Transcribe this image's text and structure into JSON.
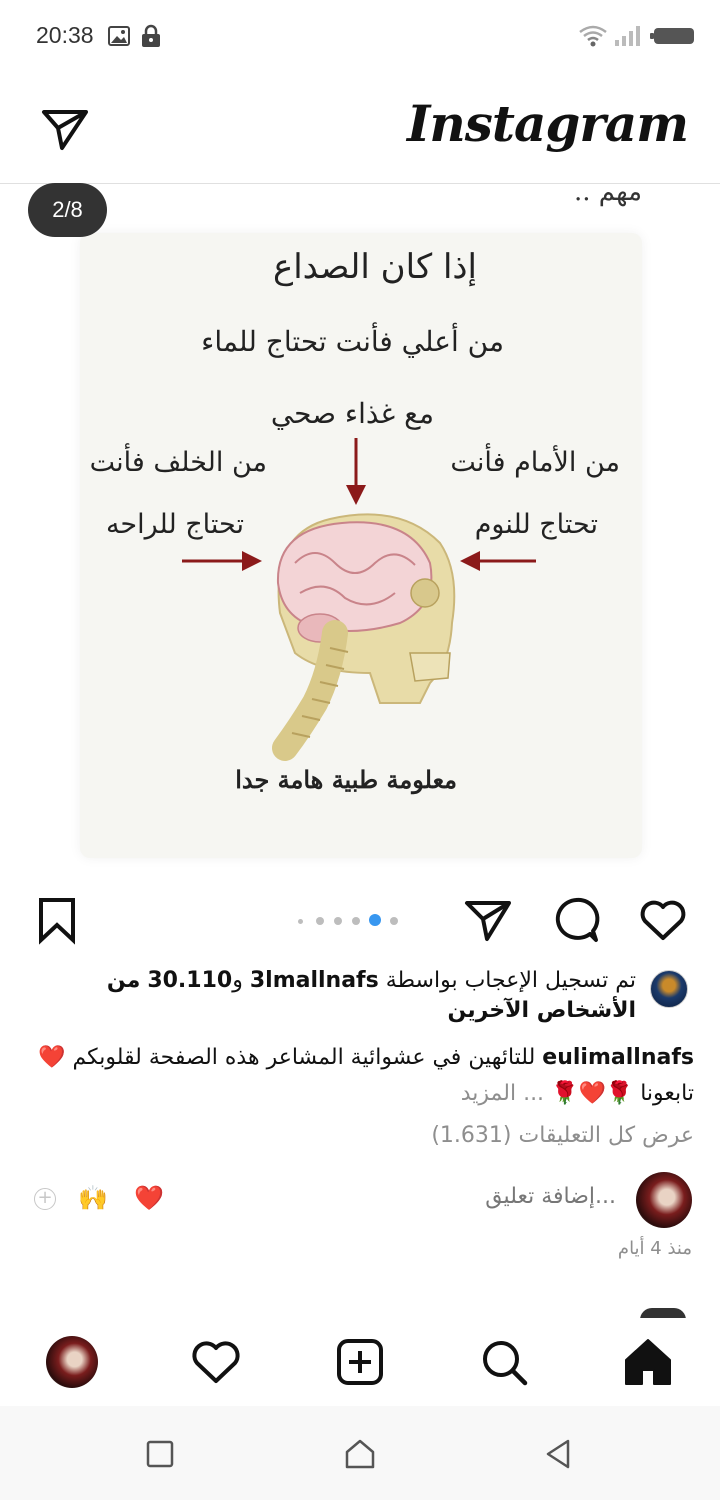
{
  "status_bar": {
    "time": "20:38",
    "icons": [
      "image-icon",
      "lock-icon",
      "wifi-icon",
      "signal-icon",
      "battery-icon"
    ]
  },
  "header": {
    "logo_text": "Instagram",
    "dm_icon": "paper-plane-icon"
  },
  "post": {
    "counter": "2/8",
    "cutoff_top_text": "مهم ..",
    "image_text": {
      "title": "إذا كان الصداع",
      "top_line": "من أعلي فأنت تحتاج للماء",
      "top_line2": "مع غذاء صحي",
      "left_line1": "من الخلف فأنت",
      "left_line2": "تحتاج للراحه",
      "right_line1": "من الأمام فأنت",
      "right_line2": "تحتاج للنوم",
      "footer": "معلومة طبية هامة جدا"
    },
    "carousel": {
      "total": 6,
      "active": 4
    },
    "likes": {
      "prefix": "تم تسجيل الإعجاب بواسطة",
      "user": "3lmallnafs",
      "conj": "و",
      "count": "30.110",
      "suffix_bold": "من الأشخاص الآخرين"
    },
    "caption": {
      "username": "eulimallnafs",
      "text": "للتائهين في عشوائية المشاعر هذه الصفحة لقلوبكم ❤️ تابعونا 🌹❤️🌹",
      "more": "... المزيد"
    },
    "view_comments": "عرض كل التعليقات (1.631)",
    "add_comment_placeholder": "إضافة تعليق...",
    "quick_emojis": [
      "❤️",
      "🙌"
    ],
    "time_ago": "منذ 4 أيام"
  },
  "colors": {
    "accent_blue": "#3897f0",
    "muted_gray": "#8e8e8e",
    "arrow_red": "#8b1a1a"
  }
}
